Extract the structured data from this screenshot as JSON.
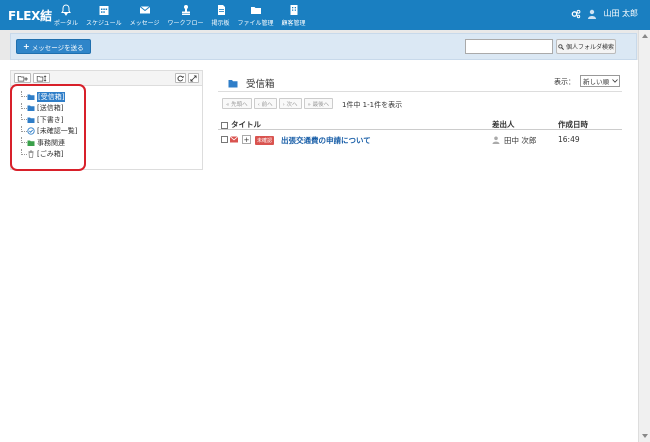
{
  "app": {
    "logo": "FLEX結"
  },
  "nav": [
    {
      "label": "ポータル",
      "icon": "bell-icon"
    },
    {
      "label": "スケジュール",
      "icon": "calendar-icon"
    },
    {
      "label": "メッセージ",
      "icon": "envelope-icon"
    },
    {
      "label": "ワークフロー",
      "icon": "stamp-icon"
    },
    {
      "label": "掲示板",
      "icon": "document-icon"
    },
    {
      "label": "ファイル管理",
      "icon": "folder-icon"
    },
    {
      "label": "顧客管理",
      "icon": "building-icon"
    }
  ],
  "user": {
    "name": "山田 太郎"
  },
  "toolbar": {
    "send_label": "メッセージを送る",
    "search_value": "",
    "search_button": "個人フォルダ検索"
  },
  "folders": [
    {
      "label": "[受信箱]",
      "icon": "folder-icon",
      "active": true
    },
    {
      "label": "[送信箱]",
      "icon": "folder-icon"
    },
    {
      "label": "[下書き]",
      "icon": "folder-icon"
    },
    {
      "label": "[未確認一覧]",
      "icon": "check-circle-icon"
    },
    {
      "label": "事務関連",
      "icon": "folder-icon"
    },
    {
      "label": "[ごみ箱]",
      "icon": "trash-icon"
    }
  ],
  "main": {
    "title": "受信箱",
    "display_label": "表示：",
    "sort_value": "新しい順",
    "pager": [
      "« 先頭へ",
      "‹ 前へ",
      "› 次へ",
      "» 最後へ"
    ],
    "count": "1件中 1-1件を表示",
    "columns": {
      "title": "タイトル",
      "sender": "差出人",
      "date": "作成日時"
    },
    "rows": [
      {
        "badge": "未確認",
        "subject": "出張交通費の申請について",
        "sender": "田中 次郎",
        "time": "16:49"
      }
    ]
  },
  "colors": {
    "topbar": "#1a7fc1",
    "accent": "#2f85c9",
    "badge": "#d9534f",
    "highlight": "#d8202a"
  }
}
